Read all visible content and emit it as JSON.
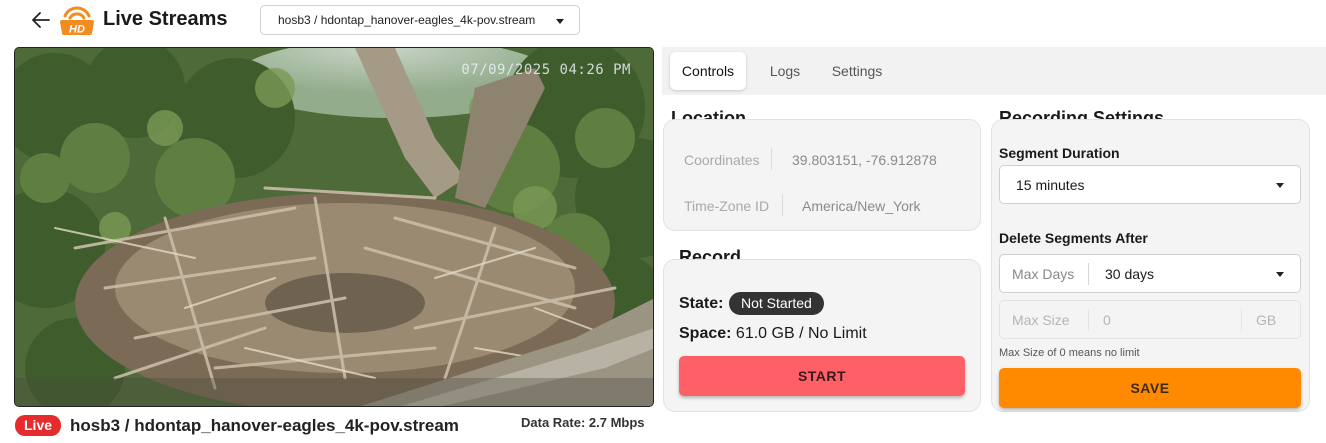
{
  "header": {
    "title": "Live Streams",
    "stream_selector_value": "hosb3 / hdontap_hanover-eagles_4k-pov.stream",
    "logo_text": "HD"
  },
  "video": {
    "timestamp": "07/09/2025 04:26 PM",
    "live_label": "Live",
    "caption": "hosb3 / hdontap_hanover-eagles_4k-pov.stream",
    "data_rate": "Data Rate: 2.7 Mbps"
  },
  "tabs": [
    {
      "label": "Controls",
      "active": true
    },
    {
      "label": "Logs",
      "active": false
    },
    {
      "label": "Settings",
      "active": false
    }
  ],
  "location": {
    "title": "Location",
    "coordinates_label": "Coordinates",
    "coordinates_value": "39.803151, -76.912878",
    "timezone_label": "Time-Zone ID",
    "timezone_value": "America/New_York"
  },
  "record": {
    "title": "Record",
    "state_label": "State:",
    "state_value": "Not Started",
    "space_label": "Space:",
    "space_value": "61.0 GB / No Limit",
    "start_label": "START"
  },
  "recording_settings": {
    "title": "Recording Settings",
    "segment_duration_label": "Segment Duration",
    "segment_duration_value": "15 minutes",
    "delete_after_label": "Delete Segments After",
    "max_days_label": "Max Days",
    "max_days_value": "30 days",
    "max_size_label": "Max Size",
    "max_size_value": "0",
    "max_size_unit": "GB",
    "helper_text": "Max Size of 0 means no limit",
    "save_label": "SAVE"
  },
  "colors": {
    "live_red": "#e52b2b",
    "start_button": "#ff5f66",
    "save_button": "#ff8a00",
    "logo_orange": "#f28c1e"
  }
}
